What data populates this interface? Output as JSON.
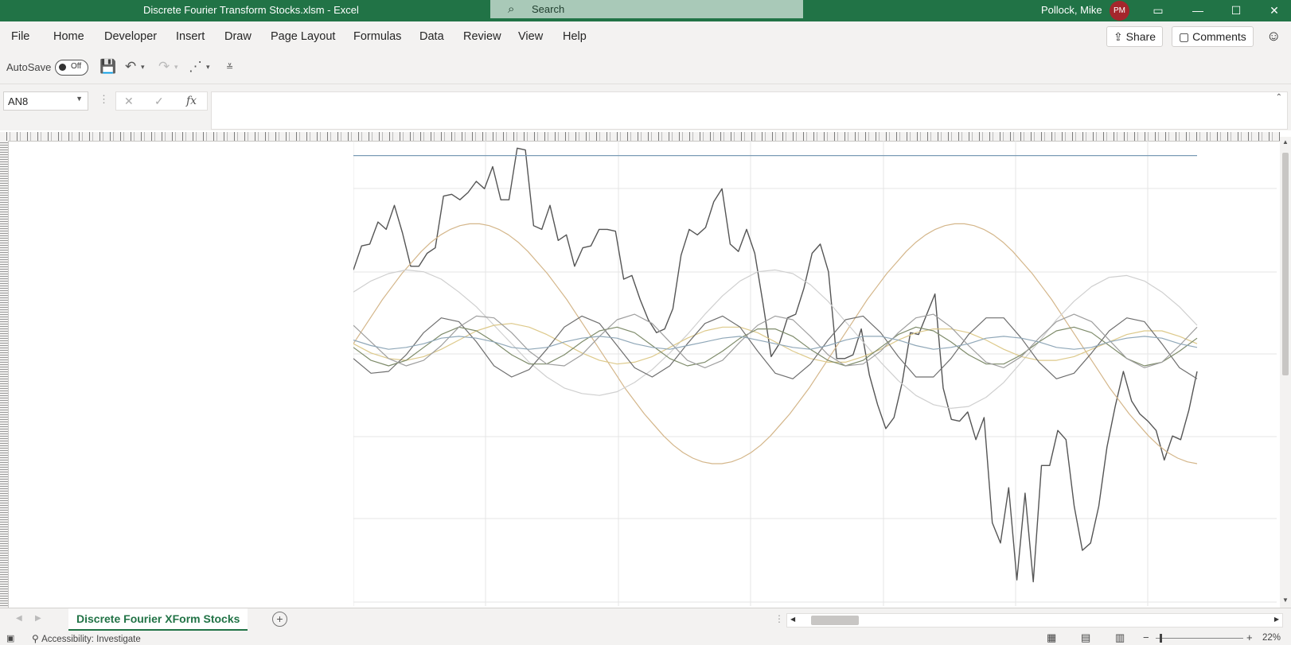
{
  "window": {
    "title": "Discrete Fourier Transform Stocks.xlsm  -  Excel",
    "search_placeholder": "Search",
    "user_name": "Pollock, Mike",
    "user_initials": "PM"
  },
  "menu": {
    "tabs": [
      "File",
      "Home",
      "Developer",
      "Insert",
      "Draw",
      "Page Layout",
      "Formulas",
      "Data",
      "Review",
      "View",
      "Help"
    ],
    "share_label": "Share",
    "comments_label": "Comments"
  },
  "qat": {
    "autosave_label": "AutoSave",
    "autosave_state": "Off"
  },
  "formula_bar": {
    "name_box": "AN8",
    "fx_label": "fx",
    "formula": ""
  },
  "sheet_tabs": {
    "active": "Discrete Fourier XForm Stocks"
  },
  "status": {
    "accessibility": "Accessibility: Investigate",
    "zoom": "22%"
  },
  "colors": {
    "excel_green": "#217346",
    "avatar_red": "#a4262c"
  },
  "chart_data": {
    "type": "line",
    "title": "",
    "xlabel": "",
    "ylabel": "",
    "x_samples": 89,
    "note_axes": "no tick labels visible at 22% zoom",
    "series": [
      {
        "color": "#555555",
        "values": [
          300,
          287,
          286,
          274,
          278,
          265,
          280,
          298,
          298,
          291,
          288,
          260,
          259,
          262,
          258,
          252,
          256,
          244,
          262,
          262,
          234,
          235,
          276,
          278,
          265,
          284,
          281,
          298,
          288,
          287,
          278,
          278,
          279,
          305,
          303,
          316,
          327,
          334,
          332,
          321,
          292,
          278,
          281,
          277,
          263,
          256,
          286,
          290,
          278,
          291,
          318,
          347,
          340,
          326,
          324,
          310,
          291,
          286,
          301,
          348,
          348,
          346,
          332,
          357,
          373,
          386,
          380,
          361,
          334,
          335,
          324,
          313,
          364,
          381,
          382,
          377,
          392,
          380,
          437,
          448,
          418,
          468,
          421,
          469,
          406,
          406,
          387,
          392,
          428,
          452,
          448,
          428,
          396,
          374,
          355,
          371,
          378,
          382,
          387,
          403,
          390,
          392,
          376,
          355
        ]
      },
      {
        "color": "#7a9bb5",
        "values": [
          238,
          238,
          238,
          238,
          238,
          238,
          238,
          238,
          238,
          238,
          238,
          238,
          238,
          238,
          238,
          238,
          238,
          238,
          238,
          238,
          238,
          238,
          238,
          238,
          238,
          238,
          238,
          238,
          238,
          238,
          238,
          238,
          238,
          238,
          238,
          238,
          238,
          238,
          238,
          238,
          238,
          238,
          238,
          238,
          238,
          238,
          238,
          238,
          238,
          238,
          238,
          238,
          238,
          238,
          238,
          238,
          238,
          238,
          238,
          238,
          238,
          238,
          238,
          238,
          238,
          238,
          238,
          238,
          238,
          238,
          238,
          238,
          238,
          238,
          238,
          238,
          238,
          238,
          238,
          238,
          238,
          238,
          238,
          238,
          238,
          238,
          238,
          238
        ]
      },
      {
        "color": "#d4b68a",
        "values": [
          340,
          332,
          324,
          316,
          309,
          302,
          296,
          290,
          285,
          281,
          278,
          276,
          275,
          275,
          276,
          278,
          281,
          285,
          290,
          296,
          302,
          309,
          316,
          324,
          332,
          340,
          348,
          356,
          364,
          371,
          378,
          384,
          390,
          395,
          399,
          402,
          404,
          405,
          405,
          404,
          402,
          399,
          395,
          390,
          384,
          378,
          371,
          364,
          356,
          348,
          340,
          332,
          324,
          316,
          309,
          302,
          296,
          290,
          285,
          281,
          278,
          276,
          275,
          275,
          276,
          278,
          281,
          285,
          290,
          296,
          302,
          309,
          316,
          324,
          332,
          340,
          348,
          356,
          364,
          371,
          378,
          384,
          390,
          395,
          399,
          402,
          404,
          405
        ]
      },
      {
        "color": "#cfcfcf",
        "values": [
          312,
          306,
          302,
          300,
          301,
          305,
          312,
          320,
          330,
          340,
          350,
          358,
          364,
          367,
          368,
          366,
          361,
          354,
          345,
          335,
          324,
          314,
          306,
          301,
          300,
          302,
          308,
          317,
          328,
          339,
          350,
          360,
          368,
          373,
          375,
          374,
          369,
          361,
          350,
          339,
          327,
          317,
          309,
          304,
          303,
          306,
          312,
          320,
          330
        ]
      },
      {
        "color": "#ddc98a",
        "values": [
          340,
          345,
          348,
          349,
          347,
          343,
          338,
          333,
          330,
          329,
          331,
          335,
          340,
          345,
          349,
          351,
          350,
          347,
          342,
          337,
          333,
          331,
          331,
          334,
          339,
          344,
          348,
          350,
          350,
          347,
          343,
          338,
          334,
          332,
          332,
          334,
          338,
          343,
          347,
          349,
          349,
          347,
          343,
          339,
          335,
          333,
          333,
          336,
          340
        ]
      },
      {
        "color": "#6e6e6e",
        "values": [
          348,
          356,
          355,
          346,
          334,
          326,
          328,
          339,
          352,
          358,
          354,
          343,
          331,
          325,
          329,
          341,
          353,
          358,
          352,
          340,
          329,
          325,
          331,
          344,
          356,
          359,
          351,
          338,
          327,
          325,
          334,
          347,
          358,
          358,
          348,
          335,
          326,
          326,
          337,
          350,
          359,
          356,
          345,
          333,
          326,
          328,
          340,
          353,
          359
        ]
      },
      {
        "color": "#7e8b6a",
        "values": [
          342,
          349,
          352,
          349,
          342,
          335,
          331,
          333,
          339,
          346,
          351,
          351,
          346,
          339,
          333,
          331,
          334,
          341,
          348,
          352,
          350,
          344,
          337,
          332,
          332,
          336,
          343,
          349,
          352,
          349,
          342,
          335,
          331,
          333,
          339,
          346,
          351,
          351,
          346,
          339,
          333,
          331,
          334,
          341,
          348,
          352,
          350,
          344,
          337
        ]
      },
      {
        "color": "#9e9e9e",
        "values": [
          330,
          339,
          348,
          352,
          349,
          341,
          331,
          325,
          326,
          334,
          344,
          351,
          352,
          346,
          336,
          327,
          324,
          329,
          339,
          349,
          353,
          349,
          339,
          330,
          325,
          327,
          336,
          346,
          352,
          351,
          344,
          334,
          326,
          324,
          331,
          341,
          350,
          353,
          347,
          337,
          328,
          324,
          328,
          338,
          348,
          353,
          350,
          341,
          331
        ]
      },
      {
        "color": "#8fa7b8",
        "values": [
          338,
          341,
          343,
          342,
          340,
          337,
          336,
          337,
          339,
          342,
          343,
          342,
          339,
          337,
          336,
          337,
          340,
          342,
          343,
          341,
          339,
          337,
          336,
          338,
          340,
          342,
          343,
          341,
          338,
          336,
          336,
          338,
          341,
          343,
          342,
          340,
          337,
          336,
          337,
          339,
          342,
          343,
          342,
          339,
          337,
          336,
          337,
          340,
          342
        ]
      }
    ]
  }
}
